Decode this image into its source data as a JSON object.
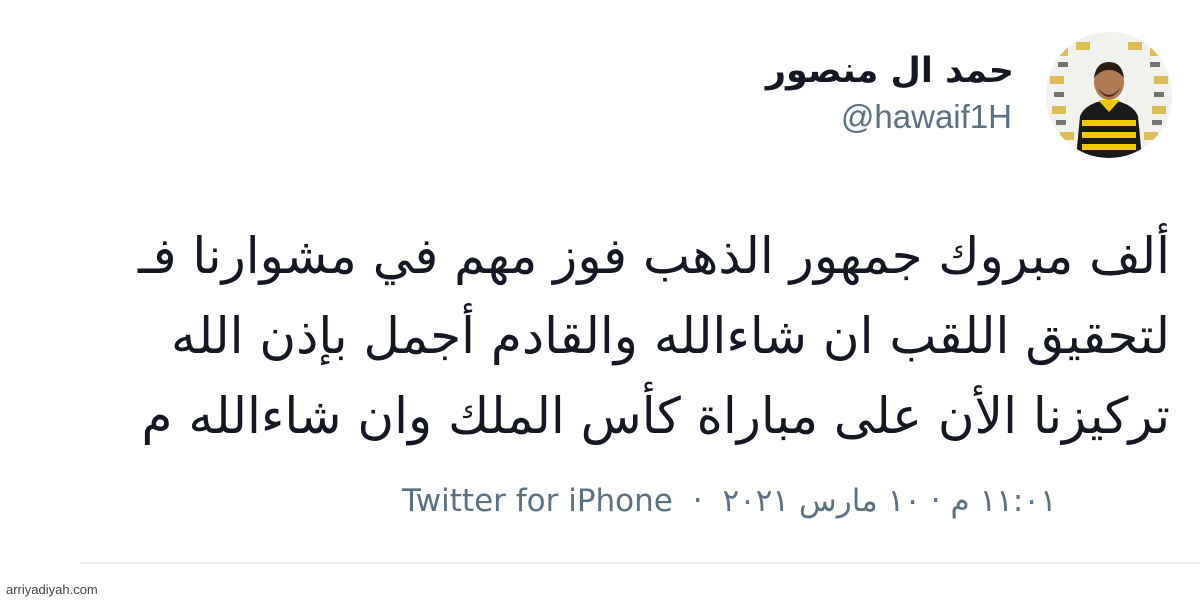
{
  "author": {
    "display_name": "حمد ال منصور",
    "handle": "@hawaif1H",
    "avatar_icon": "avatar-photo-icon"
  },
  "tweet": {
    "lines": [
      "ألف مبروك جمهور الذهب فوز مهم في مشوارنا فـ",
      "لتحقيق اللقب ان شاءالله والقادم أجمل بإذن الله",
      "تركيزنا الأن على مباراة كأس الملك وان شاءالله م"
    ]
  },
  "meta": {
    "time_date": "١١:٠١ م · ١٠ مارس ٢٠٢١",
    "separator": "·",
    "source": "Twitter for iPhone"
  },
  "watermark": "arriyadiyah.com",
  "colors": {
    "text_primary": "#141823",
    "text_secondary": "#5b7083",
    "divider": "#e6ecf0",
    "jersey_yellow": "#f2c713",
    "jersey_black": "#1a1a1a"
  }
}
